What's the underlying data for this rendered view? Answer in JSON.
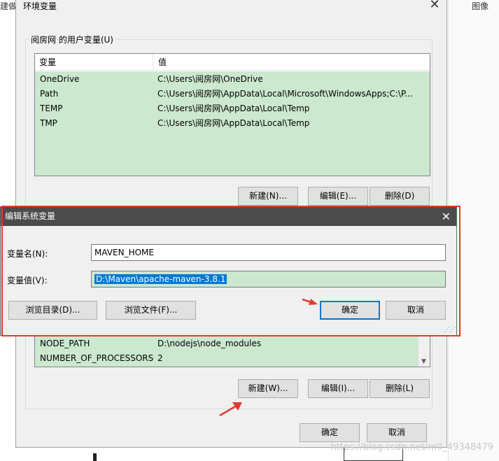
{
  "background": {
    "left_text": "建做",
    "right_text": "图像"
  },
  "env_dialog": {
    "title": "环境变量",
    "close_glyph": "✕",
    "user_group_label": "阅房网 的用户变量(U)",
    "columns": [
      "变量",
      "值"
    ],
    "user_vars": [
      {
        "name": "OneDrive",
        "value": "C:\\Users\\阅房网\\OneDrive"
      },
      {
        "name": "Path",
        "value": "C:\\Users\\阅房网\\AppData\\Local\\Microsoft\\WindowsApps;C:\\P..."
      },
      {
        "name": "TEMP",
        "value": "C:\\Users\\阅房网\\AppData\\Local\\Temp"
      },
      {
        "name": "TMP",
        "value": "C:\\Users\\阅房网\\AppData\\Local\\Temp"
      }
    ],
    "user_buttons": {
      "new": "新建(N)...",
      "edit": "编辑(E)...",
      "delete": "删除(D)"
    },
    "sys_vars": [
      {
        "name": "NODE_PATH",
        "value": "D:\\nodejs\\node_modules"
      },
      {
        "name": "NUMBER_OF_PROCESSORS",
        "value": "2"
      }
    ],
    "sys_buttons": {
      "new": "新建(W)...",
      "edit": "编辑(I)...",
      "delete": "删除(L)"
    },
    "ok": "确定",
    "cancel": "取消"
  },
  "edit_dialog": {
    "title": "编辑系统变量",
    "close_glyph": "✕",
    "name_label": "变量名(N):",
    "name_value": "MAVEN_HOME",
    "value_label": "变量值(V):",
    "value_value": "D:\\Maven\\apache-maven-3.8.1",
    "browse_dir": "浏览目录(D)...",
    "browse_file": "浏览文件(F)...",
    "ok": "确定",
    "cancel": "取消"
  },
  "watermark": "https://blog.csdn.net/m0_49348479",
  "colors": {
    "annotation": "#e33b2b",
    "selection": "#0078d7",
    "list_bg": "#cce8cf"
  }
}
